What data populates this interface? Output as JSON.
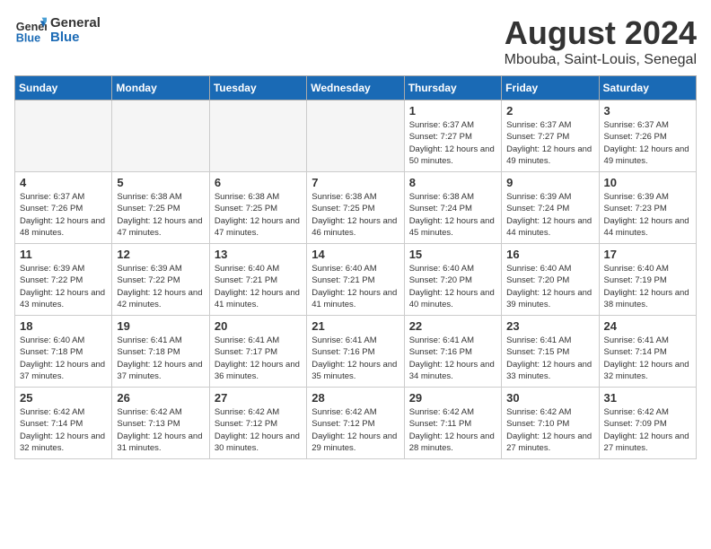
{
  "header": {
    "logo_line1": "General",
    "logo_line2": "Blue",
    "title": "August 2024",
    "subtitle": "Mbouba, Saint-Louis, Senegal"
  },
  "days_of_week": [
    "Sunday",
    "Monday",
    "Tuesday",
    "Wednesday",
    "Thursday",
    "Friday",
    "Saturday"
  ],
  "weeks": [
    [
      {
        "day": "",
        "empty": true
      },
      {
        "day": "",
        "empty": true
      },
      {
        "day": "",
        "empty": true
      },
      {
        "day": "",
        "empty": true
      },
      {
        "day": "1",
        "sunrise": "6:37 AM",
        "sunset": "7:27 PM",
        "daylight": "12 hours and 50 minutes."
      },
      {
        "day": "2",
        "sunrise": "6:37 AM",
        "sunset": "7:27 PM",
        "daylight": "12 hours and 49 minutes."
      },
      {
        "day": "3",
        "sunrise": "6:37 AM",
        "sunset": "7:26 PM",
        "daylight": "12 hours and 49 minutes."
      }
    ],
    [
      {
        "day": "4",
        "sunrise": "6:37 AM",
        "sunset": "7:26 PM",
        "daylight": "12 hours and 48 minutes."
      },
      {
        "day": "5",
        "sunrise": "6:38 AM",
        "sunset": "7:25 PM",
        "daylight": "12 hours and 47 minutes."
      },
      {
        "day": "6",
        "sunrise": "6:38 AM",
        "sunset": "7:25 PM",
        "daylight": "12 hours and 47 minutes."
      },
      {
        "day": "7",
        "sunrise": "6:38 AM",
        "sunset": "7:25 PM",
        "daylight": "12 hours and 46 minutes."
      },
      {
        "day": "8",
        "sunrise": "6:38 AM",
        "sunset": "7:24 PM",
        "daylight": "12 hours and 45 minutes."
      },
      {
        "day": "9",
        "sunrise": "6:39 AM",
        "sunset": "7:24 PM",
        "daylight": "12 hours and 44 minutes."
      },
      {
        "day": "10",
        "sunrise": "6:39 AM",
        "sunset": "7:23 PM",
        "daylight": "12 hours and 44 minutes."
      }
    ],
    [
      {
        "day": "11",
        "sunrise": "6:39 AM",
        "sunset": "7:22 PM",
        "daylight": "12 hours and 43 minutes."
      },
      {
        "day": "12",
        "sunrise": "6:39 AM",
        "sunset": "7:22 PM",
        "daylight": "12 hours and 42 minutes."
      },
      {
        "day": "13",
        "sunrise": "6:40 AM",
        "sunset": "7:21 PM",
        "daylight": "12 hours and 41 minutes."
      },
      {
        "day": "14",
        "sunrise": "6:40 AM",
        "sunset": "7:21 PM",
        "daylight": "12 hours and 41 minutes."
      },
      {
        "day": "15",
        "sunrise": "6:40 AM",
        "sunset": "7:20 PM",
        "daylight": "12 hours and 40 minutes."
      },
      {
        "day": "16",
        "sunrise": "6:40 AM",
        "sunset": "7:20 PM",
        "daylight": "12 hours and 39 minutes."
      },
      {
        "day": "17",
        "sunrise": "6:40 AM",
        "sunset": "7:19 PM",
        "daylight": "12 hours and 38 minutes."
      }
    ],
    [
      {
        "day": "18",
        "sunrise": "6:40 AM",
        "sunset": "7:18 PM",
        "daylight": "12 hours and 37 minutes."
      },
      {
        "day": "19",
        "sunrise": "6:41 AM",
        "sunset": "7:18 PM",
        "daylight": "12 hours and 37 minutes."
      },
      {
        "day": "20",
        "sunrise": "6:41 AM",
        "sunset": "7:17 PM",
        "daylight": "12 hours and 36 minutes."
      },
      {
        "day": "21",
        "sunrise": "6:41 AM",
        "sunset": "7:16 PM",
        "daylight": "12 hours and 35 minutes."
      },
      {
        "day": "22",
        "sunrise": "6:41 AM",
        "sunset": "7:16 PM",
        "daylight": "12 hours and 34 minutes."
      },
      {
        "day": "23",
        "sunrise": "6:41 AM",
        "sunset": "7:15 PM",
        "daylight": "12 hours and 33 minutes."
      },
      {
        "day": "24",
        "sunrise": "6:41 AM",
        "sunset": "7:14 PM",
        "daylight": "12 hours and 32 minutes."
      }
    ],
    [
      {
        "day": "25",
        "sunrise": "6:42 AM",
        "sunset": "7:14 PM",
        "daylight": "12 hours and 32 minutes."
      },
      {
        "day": "26",
        "sunrise": "6:42 AM",
        "sunset": "7:13 PM",
        "daylight": "12 hours and 31 minutes."
      },
      {
        "day": "27",
        "sunrise": "6:42 AM",
        "sunset": "7:12 PM",
        "daylight": "12 hours and 30 minutes."
      },
      {
        "day": "28",
        "sunrise": "6:42 AM",
        "sunset": "7:12 PM",
        "daylight": "12 hours and 29 minutes."
      },
      {
        "day": "29",
        "sunrise": "6:42 AM",
        "sunset": "7:11 PM",
        "daylight": "12 hours and 28 minutes."
      },
      {
        "day": "30",
        "sunrise": "6:42 AM",
        "sunset": "7:10 PM",
        "daylight": "12 hours and 27 minutes."
      },
      {
        "day": "31",
        "sunrise": "6:42 AM",
        "sunset": "7:09 PM",
        "daylight": "12 hours and 27 minutes."
      }
    ]
  ]
}
